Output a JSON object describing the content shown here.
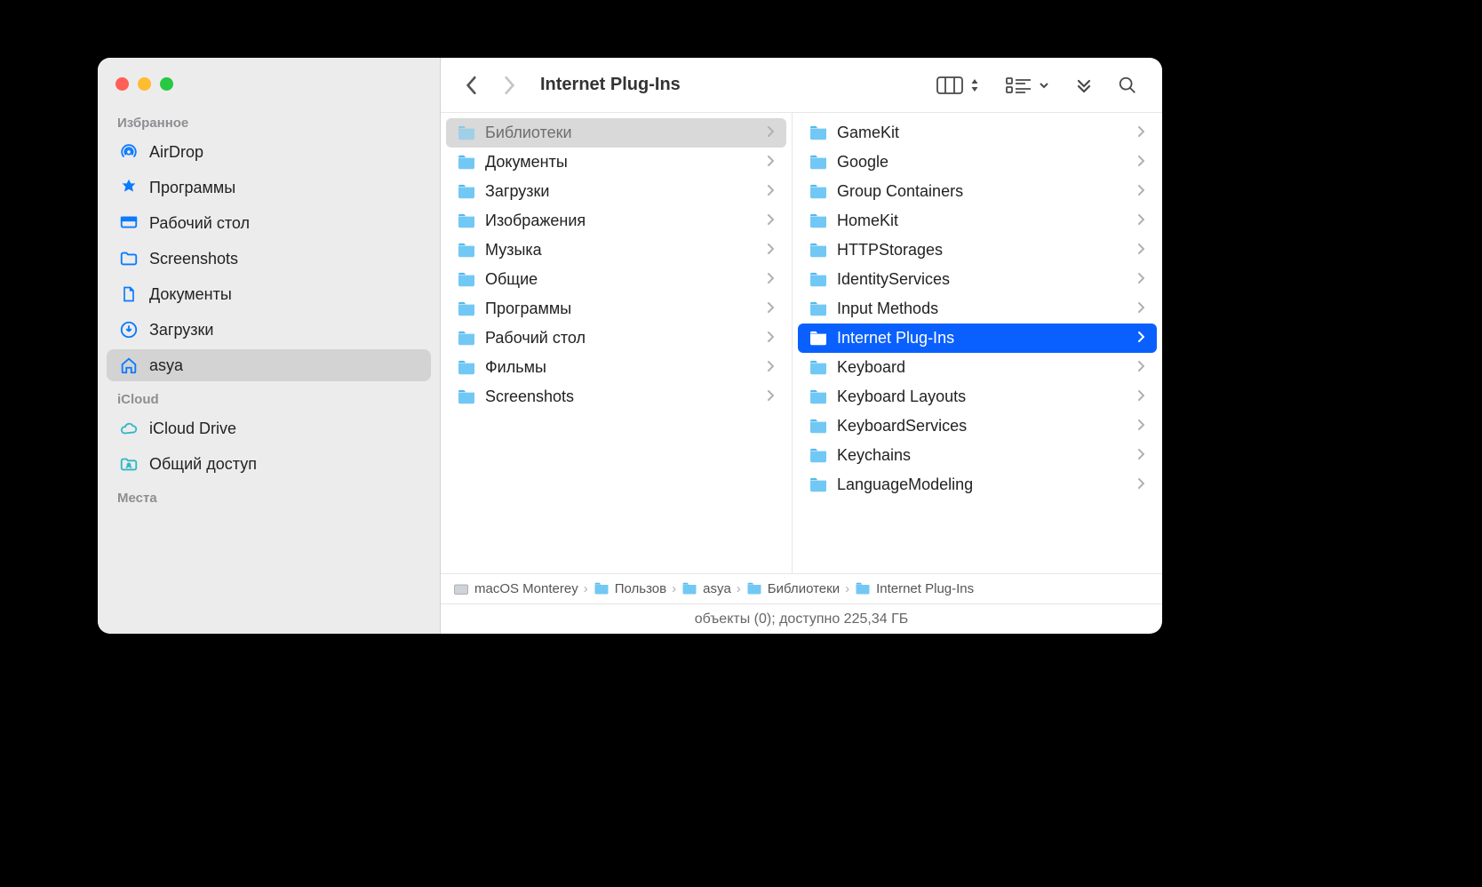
{
  "window_title": "Internet Plug-Ins",
  "sidebar": {
    "sections": [
      {
        "label": "Избранное",
        "items": [
          {
            "icon": "airdrop",
            "label": "AirDrop"
          },
          {
            "icon": "apps",
            "label": "Программы"
          },
          {
            "icon": "desktop",
            "label": "Рабочий стол"
          },
          {
            "icon": "folder",
            "label": "Screenshots"
          },
          {
            "icon": "doc",
            "label": "Документы"
          },
          {
            "icon": "download",
            "label": "Загрузки"
          },
          {
            "icon": "home",
            "label": "asya",
            "selected": true
          }
        ]
      },
      {
        "label": "iCloud",
        "items": [
          {
            "icon": "cloud",
            "label": "iCloud Drive",
            "color": "teal"
          },
          {
            "icon": "shared",
            "label": "Общий доступ",
            "color": "teal"
          }
        ]
      },
      {
        "label": "Места",
        "items": []
      }
    ]
  },
  "columns": [
    {
      "items": [
        {
          "label": "Библиотеки",
          "folder": true,
          "dim": true
        },
        {
          "label": "Документы",
          "folder": true
        },
        {
          "label": "Загрузки",
          "folder": true
        },
        {
          "label": "Изображения",
          "folder": true
        },
        {
          "label": "Музыка",
          "folder": true
        },
        {
          "label": "Общие",
          "folder": true
        },
        {
          "label": "Программы",
          "folder": true
        },
        {
          "label": "Рабочий стол",
          "folder": true
        },
        {
          "label": "Фильмы",
          "folder": true
        },
        {
          "label": "Screenshots",
          "folder": true
        }
      ]
    },
    {
      "items": [
        {
          "label": "GameKit",
          "folder": true
        },
        {
          "label": "Google",
          "folder": true
        },
        {
          "label": "Group Containers",
          "folder": true
        },
        {
          "label": "HomeKit",
          "folder": true
        },
        {
          "label": "HTTPStorages",
          "folder": true
        },
        {
          "label": "IdentityServices",
          "folder": true
        },
        {
          "label": "Input Methods",
          "folder": true
        },
        {
          "label": "Internet Plug-Ins",
          "folder": true,
          "selected": true
        },
        {
          "label": "Keyboard",
          "folder": true
        },
        {
          "label": "Keyboard Layouts",
          "folder": true
        },
        {
          "label": "KeyboardServices",
          "folder": true
        },
        {
          "label": "Keychains",
          "folder": true
        },
        {
          "label": "LanguageModeling",
          "folder": true
        }
      ]
    }
  ],
  "pathbar": [
    {
      "icon": "disk",
      "label": "macOS Monterey"
    },
    {
      "icon": "folder",
      "label": "Пользов"
    },
    {
      "icon": "folder",
      "label": "asya"
    },
    {
      "icon": "folder",
      "label": "Библиотеки"
    },
    {
      "icon": "folder",
      "label": "Internet Plug-Ins"
    }
  ],
  "status": "объекты (0); доступно 225,34 ГБ"
}
